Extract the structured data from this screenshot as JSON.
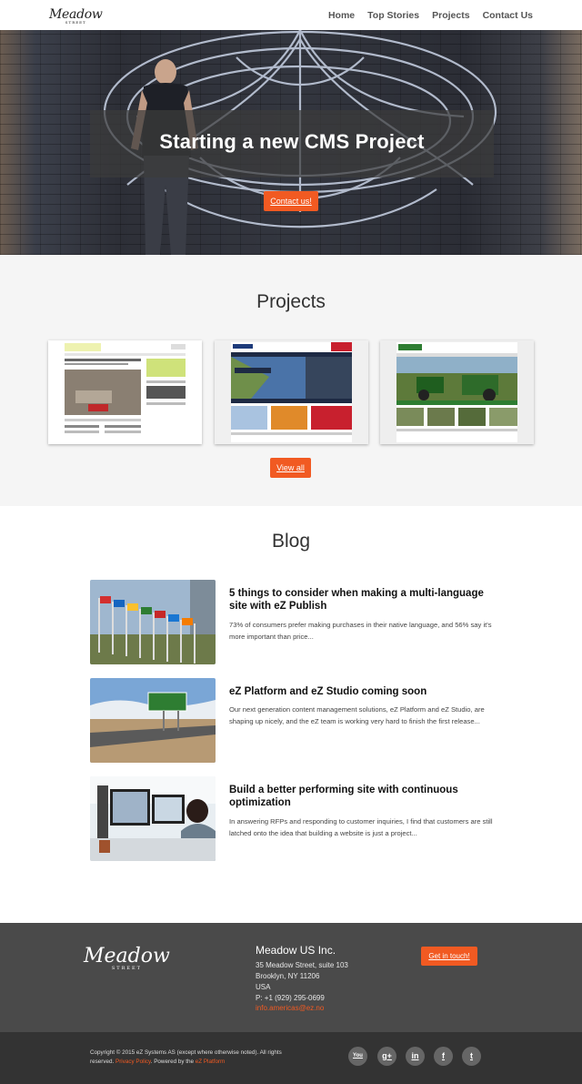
{
  "nav": {
    "logo": "Meadow",
    "logo_sub": "STREET",
    "links": [
      "Home",
      "Top Stories",
      "Projects",
      "Contact Us"
    ]
  },
  "hero": {
    "title": "Starting a new CMS Project",
    "button": "Contact us!"
  },
  "projects": {
    "title": "Projects",
    "thumbnails": [
      {
        "site": "la Nouvelle République",
        "headline": "Crash en Égypte : Moscou admet la possibilité d'un \"acte terroriste\""
      },
      {
        "site": "MAZARS",
        "headline": "MAZARS"
      },
      {
        "site": "John Deere",
        "headline": "John Deere"
      }
    ],
    "button": "View all"
  },
  "blog": {
    "title": "Blog",
    "posts": [
      {
        "title": "5 things to consider when making a multi-language site with eZ Publish",
        "excerpt": "73% of consumers prefer making purchases in their native language, and 56% say it's more important than price..."
      },
      {
        "title": "eZ Platform and eZ Studio coming soon",
        "excerpt": "Our next generation content management solutions, eZ Platform and eZ Studio, are shaping up nicely, and the eZ team is working very hard to finish the first release..."
      },
      {
        "title": "Build a better performing site with continuous optimization",
        "excerpt": "In answering RFPs and responding to customer inquiries, I find that customers are still latched onto the idea that building a website is just a project..."
      }
    ]
  },
  "footer": {
    "logo": "Meadow",
    "logo_sub": "STREET",
    "company": "Meadow US Inc.",
    "address1": "35 Meadow Street, suite 103",
    "address2": "Brooklyn, NY 11206",
    "address3": "USA",
    "phone": "P: +1 (929) 295-0699",
    "email": "info.americas@ez.no",
    "button": "Get in touch!",
    "copyright_prefix": "Copyright © 2015 eZ Systems AS (except where otherwise noted). All rights reserved.",
    "privacy": "Privacy Policy",
    "powered_prefix": ". Powered by the",
    "platform": "eZ Platform",
    "social": [
      {
        "icon": "youtube-icon",
        "glyph": "You"
      },
      {
        "icon": "google-plus-icon",
        "glyph": "g+"
      },
      {
        "icon": "linkedin-icon",
        "glyph": "in"
      },
      {
        "icon": "facebook-icon",
        "glyph": "f"
      },
      {
        "icon": "twitter-icon",
        "glyph": "t"
      }
    ]
  },
  "colors": {
    "accent": "#f15a22",
    "footer_bg": "#4a4a4a",
    "bottom_bg": "#333333",
    "projects_bg": "#f5f5f5"
  }
}
